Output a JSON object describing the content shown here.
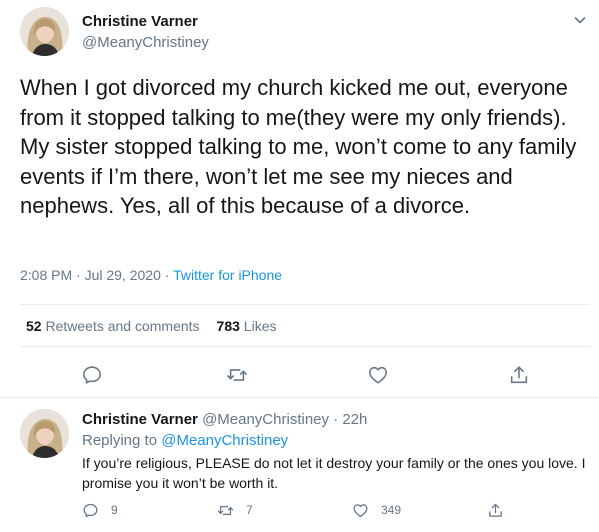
{
  "tweet": {
    "author_name": "Christine Varner",
    "author_handle": "@MeanyChristiney",
    "text": "When I got divorced my church kicked me out, everyone from it stopped talking to me(they were my only friends). My sister stopped talking to me, won’t come to any family events if I’m there, won’t let me see my nieces and nephews. Yes, all of this because of a divorce.",
    "time": "2:08 PM",
    "date": "Jul 29, 2020",
    "separator": " · ",
    "source": "Twitter for iPhone",
    "retweets_count": "52",
    "retweets_label": "Retweets and comments",
    "likes_count": "783",
    "likes_label": "Likes",
    "icons": [
      "caret-down-icon",
      "reply-icon",
      "retweet-icon",
      "like-icon",
      "share-icon"
    ]
  },
  "reply": {
    "author_name": "Christine Varner",
    "author_handle": "@MeanyChristiney",
    "separator": " · ",
    "time_ago": "22h",
    "replying_to_label": "Replying to ",
    "replying_to_handle": "@MeanyChristiney",
    "text": "If you’re religious, PLEASE do not let it destroy your family or the ones you love. I promise you it won’t be worth it.",
    "reply_count": "9",
    "retweet_count": "7",
    "like_count": "349"
  },
  "colors": {
    "accent": "#1b95e0",
    "secondary_text": "#657786",
    "primary_text": "#14171a",
    "divider": "#e6ecf0"
  }
}
